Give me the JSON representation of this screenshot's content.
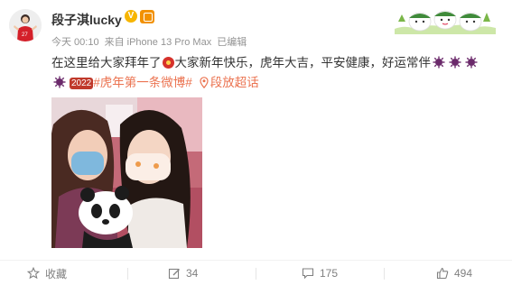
{
  "post": {
    "username": "段子淇lucky",
    "verified_badge": "V",
    "meta": {
      "time": "今天 00:10",
      "source": "来自 iPhone 13 Pro Max",
      "edited": "已编辑"
    },
    "content": {
      "line1_a": "在这里给大家拜年了",
      "line1_b": "大家新年快乐，虎年大吉，平安健康，好运常伴",
      "tag_2022": "2022",
      "hashtag": "#虎年第一条微博#",
      "super_link": "段放超话"
    }
  },
  "footer": {
    "favorite_label": "收藏",
    "repost_count": "34",
    "comment_count": "175",
    "like_count": "494"
  },
  "colors": {
    "link": "#eb7350",
    "meta": "#939393",
    "badge": "#f7b500"
  }
}
